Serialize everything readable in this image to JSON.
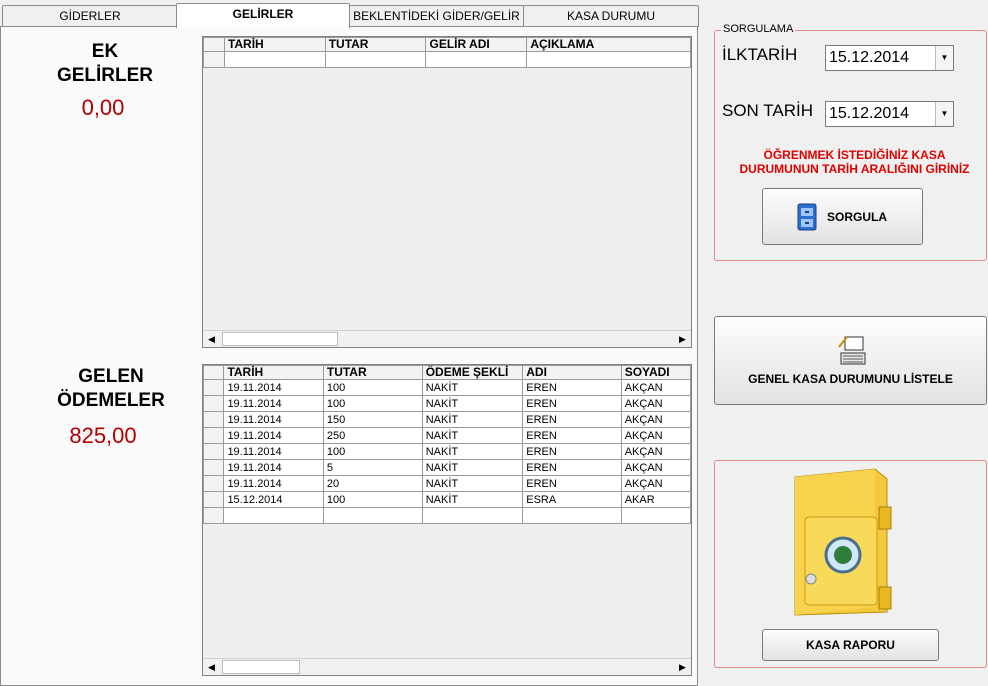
{
  "tabs": [
    {
      "label": "GİDERLER"
    },
    {
      "label": "GELİRLER"
    },
    {
      "label": "BEKLENTİDEKİ GİDER/GELİR"
    },
    {
      "label": "KASA DURUMU"
    }
  ],
  "left": {
    "ek_title_line1": "EK",
    "ek_title_line2": "GELİRLER",
    "ek_value": "0,00",
    "gelen_title_line1": "GELEN",
    "gelen_title_line2": "ÖDEMELER",
    "gelen_value": "825,00"
  },
  "ek_grid": {
    "columns": [
      "TARİH",
      "TUTAR",
      "GELİR ADI",
      "AÇIKLAMA"
    ]
  },
  "gelen_grid": {
    "columns": [
      "TARİH",
      "TUTAR",
      "ÖDEME ŞEKLİ",
      "ADI",
      "SOYADI"
    ],
    "rows": [
      [
        "19.11.2014",
        "100",
        "NAKİT",
        "EREN",
        "AKÇAN"
      ],
      [
        "19.11.2014",
        "100",
        "NAKİT",
        "EREN",
        "AKÇAN"
      ],
      [
        "19.11.2014",
        "150",
        "NAKİT",
        "EREN",
        "AKÇAN"
      ],
      [
        "19.11.2014",
        "250",
        "NAKİT",
        "EREN",
        "AKÇAN"
      ],
      [
        "19.11.2014",
        "100",
        "NAKİT",
        "EREN",
        "AKÇAN"
      ],
      [
        "19.11.2014",
        "5",
        "NAKİT",
        "EREN",
        "AKÇAN"
      ],
      [
        "19.11.2014",
        "20",
        "NAKİT",
        "EREN",
        "AKÇAN"
      ],
      [
        "15.12.2014",
        "100",
        "NAKİT",
        "ESRA",
        "AKAR"
      ]
    ]
  },
  "sorgulama": {
    "legend": "SORGULAMA",
    "ilk_label": "İLKTARİH",
    "ilk_value": "15.12.2014",
    "son_label": "SON TARİH",
    "son_value": "15.12.2014",
    "note_line1": "ÖĞRENMEK İSTEDİĞİNİZ KASA",
    "note_line2": "DURUMUNUN TARİH ARALIĞINI GİRİNİZ",
    "button": "SORGULA"
  },
  "genel_button": "GENEL KASA DURUMUNU LİSTELE",
  "rapor_button": "KASA RAPORU"
}
